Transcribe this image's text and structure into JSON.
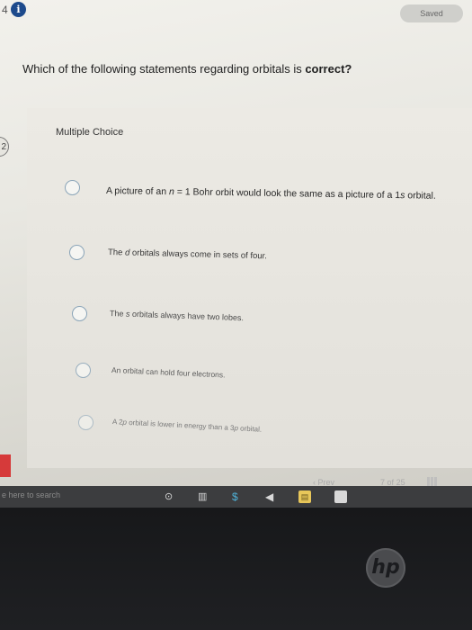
{
  "header": {
    "left_label": "4",
    "info_icon_glyph": "i",
    "saved_label": "Saved"
  },
  "question": {
    "text": "Which of the following statements regarding orbitals is ",
    "emphasis": "correct?"
  },
  "left_tab_label": "2",
  "mc_label": "Multiple Choice",
  "options": [
    {
      "pre": "A picture of an ",
      "var": "n",
      "post": " = 1 Bohr orbit would look the same as a picture of a 1",
      "var2": "s",
      "post2": " orbital."
    },
    {
      "pre": "The ",
      "var": "d",
      "post": " orbitals always come in sets of four.",
      "var2": "",
      "post2": ""
    },
    {
      "pre": "The ",
      "var": "s",
      "post": " orbitals always have two lobes.",
      "var2": "",
      "post2": ""
    },
    {
      "pre": "An orbital can hold four electrons.",
      "var": "",
      "post": "",
      "var2": "",
      "post2": ""
    },
    {
      "pre": "A 2",
      "var": "p",
      "post": " orbital is lower in energy than a 3",
      "var2": "p",
      "post2": " orbital."
    }
  ],
  "nav": {
    "prev_label": "Prev",
    "page_current": "7",
    "page_of": "of",
    "page_total": "25",
    "next_label": "N"
  },
  "taskbar": {
    "search_placeholder": "e here to search"
  },
  "brand": {
    "logo_text": "hp"
  },
  "colors": {
    "info_icon": "#1d4a8c",
    "red_accent": "#d63a3a",
    "radio_border": "#8aa4b8"
  }
}
